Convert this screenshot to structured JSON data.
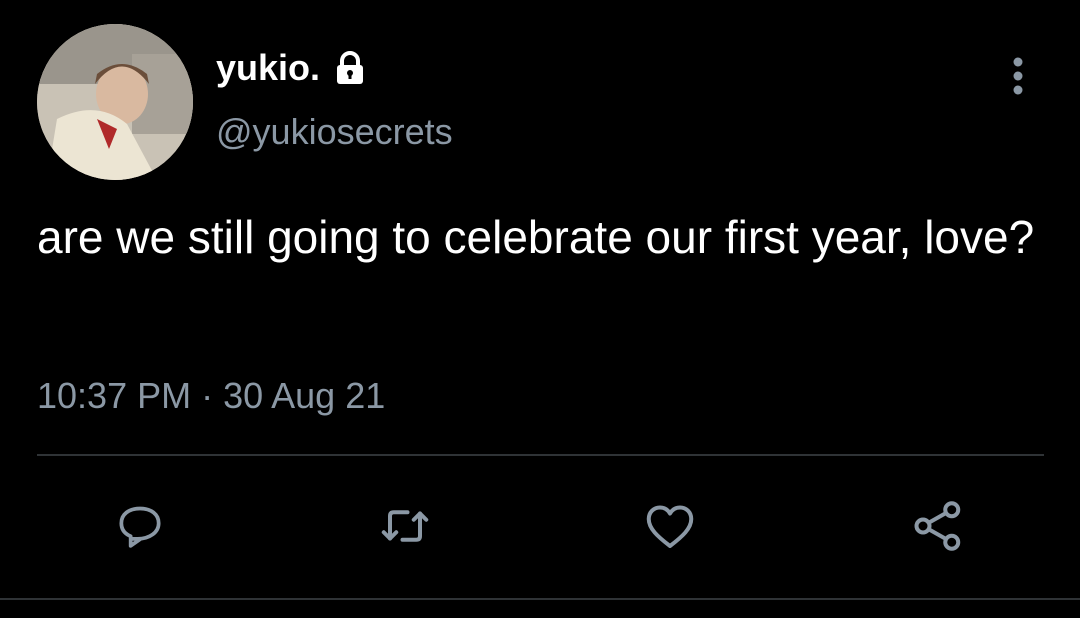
{
  "tweet": {
    "author": {
      "display_name": "yukio.",
      "handle": "@yukiosecrets",
      "protected": true,
      "avatar": "avatar-photo"
    },
    "text": "are we still going to celebrate our first year, love?",
    "timestamp": "10:37 PM · 30 Aug 21"
  },
  "actions": [
    {
      "icon": "reply-icon"
    },
    {
      "icon": "retweet-icon"
    },
    {
      "icon": "like-icon"
    },
    {
      "icon": "share-icon"
    }
  ],
  "colors": {
    "background": "#000000",
    "text_primary": "#ffffff",
    "text_secondary": "#8b98a5",
    "divider": "#2f3336"
  }
}
